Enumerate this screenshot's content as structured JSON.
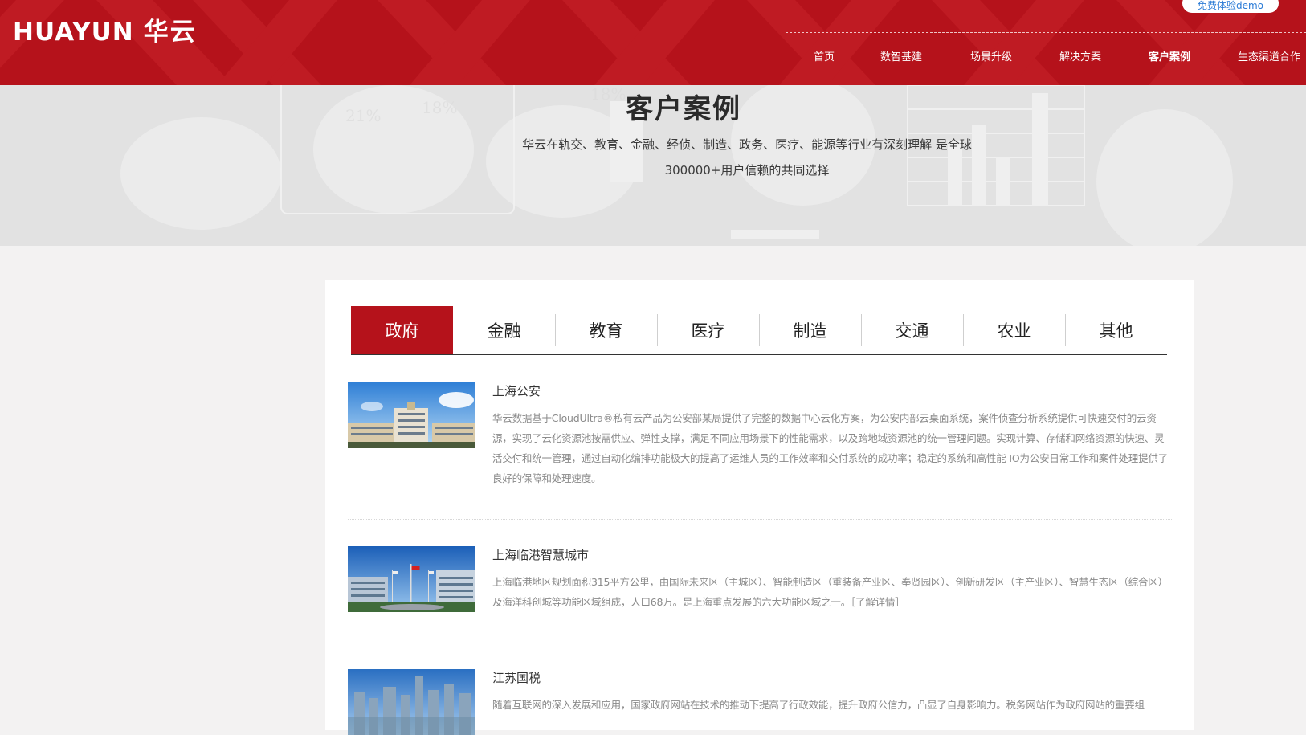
{
  "header": {
    "logo_en": "HUAYUN",
    "logo_cn": "华云",
    "demo_button": "免费体验demo",
    "nav": [
      {
        "label": "首页",
        "active": false
      },
      {
        "label": "数智基建",
        "active": false
      },
      {
        "label": "场景升级",
        "active": false
      },
      {
        "label": "解决方案",
        "active": false
      },
      {
        "label": "客户案例",
        "active": true
      },
      {
        "label": "生态渠道合作",
        "active": false
      }
    ]
  },
  "banner": {
    "title": "客户案例",
    "desc_line1": "华云在轨交、教育、金融、经侦、制造、政务、医疗、能源等行业有深刻理解 是全球",
    "desc_line2": "300000+用户信赖的共同选择"
  },
  "tabs": [
    {
      "label": "政府",
      "active": true
    },
    {
      "label": "金融",
      "active": false
    },
    {
      "label": "教育",
      "active": false
    },
    {
      "label": "医疗",
      "active": false
    },
    {
      "label": "制造",
      "active": false
    },
    {
      "label": "交通",
      "active": false
    },
    {
      "label": "农业",
      "active": false
    },
    {
      "label": "其他",
      "active": false
    }
  ],
  "cases": [
    {
      "title": "上海公安",
      "desc": "华云数据基于CloudUltra®私有云产品为公安部某局提供了完整的数据中心云化方案，为公安内部云桌面系统，案件侦查分析系统提供可快速交付的云资源，实现了云化资源池按需供应、弹性支撑，满足不同应用场景下的性能需求，以及跨地域资源池的统一管理问题。实现计算、存储和网络资源的快速、灵活交付和统一管理，通过自动化编排功能极大的提高了运维人员的工作效率和交付系统的成功率；稳定的系统和高性能 IO为公安日常工作和案件处理提供了良好的保障和处理速度。"
    },
    {
      "title": "上海临港智慧城市",
      "desc": "上海临港地区规划面积315平方公里，由国际未来区（主城区）、智能制造区（重装备产业区、奉贤园区）、创新研发区（主产业区）、智慧生态区（综合区）及海洋科创城等功能区域组成，人口68万。是上海重点发展的六大功能区域之一。［了解详情］"
    },
    {
      "title": "江苏国税",
      "desc": "随着互联网的深入发展和应用，国家政府网站在技术的推动下提高了行政效能，提升政府公信力，凸显了自身影响力。税务网站作为政府网站的重要组"
    }
  ],
  "colors": {
    "brand_red": "#b5121b",
    "demo_text": "#2b7bd6"
  }
}
